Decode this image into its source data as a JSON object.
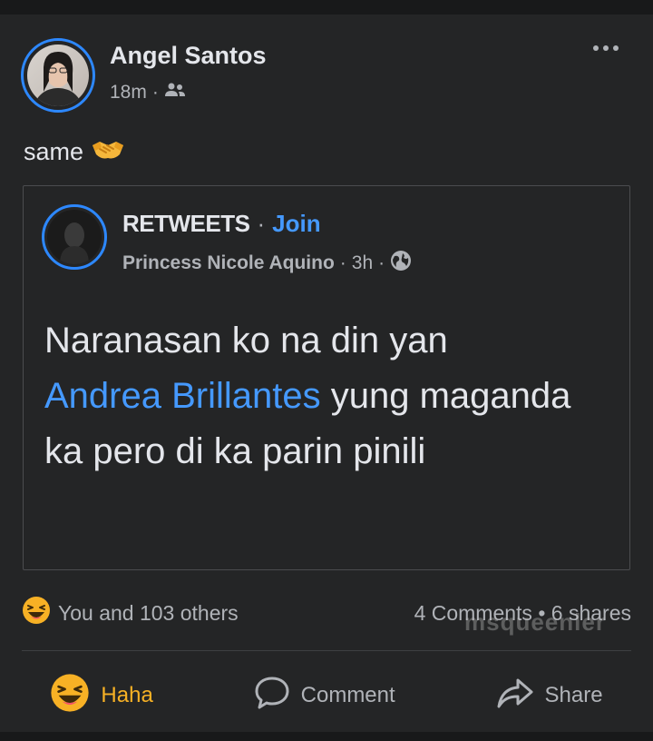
{
  "post": {
    "author": "Angel Santos",
    "time": "18m",
    "separator": "·",
    "audience_icon": "friends-icon",
    "text": "same",
    "text_emoji": "handshake-emoji",
    "more_icon": "more-options-icon"
  },
  "shared_post": {
    "group": "RETWEETS",
    "separator": "·",
    "join_label": "Join",
    "poster": "Princess Nicole Aquino",
    "time": "3h",
    "audience_icon": "globe-icon",
    "body_before": "Naranasan ko na din yan",
    "mention": "Andrea Brillantes",
    "body_after": "yung maganda ka pero di ka parin pinili"
  },
  "stats": {
    "reaction_icon": "haha-emoji",
    "reactions": "You and 103 others",
    "comments_shares": "4 Comments • 6 shares",
    "watermark": "msqueenler"
  },
  "actions": {
    "haha_label": "Haha",
    "comment_label": "Comment",
    "share_label": "Share"
  },
  "colors": {
    "background": "#242526",
    "text": "#e4e6eb",
    "secondary": "#b0b3b8",
    "link": "#4599ff",
    "haha": "#f7b125"
  }
}
